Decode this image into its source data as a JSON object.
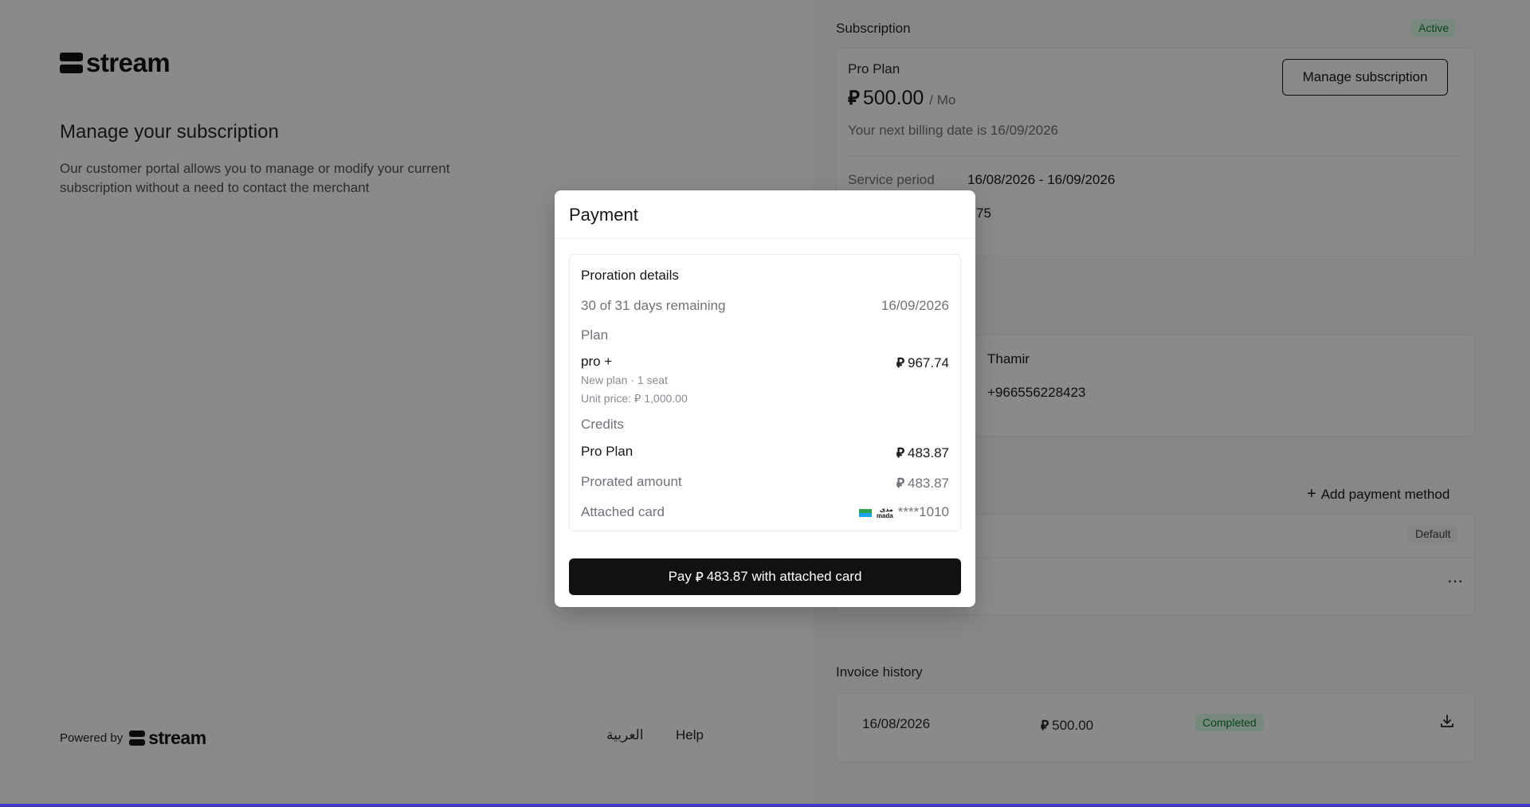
{
  "brand": {
    "wordmark": "stream"
  },
  "left": {
    "heading": "Manage your subscription",
    "description": "Our customer portal allows you to manage or modify your current subscription without a need to contact the merchant",
    "footer": {
      "powered_by": "Powered by",
      "arabic_link": "العربية",
      "help_link": "Help"
    }
  },
  "subscription": {
    "title": "Subscription",
    "status": "Active",
    "plan_name": "Pro Plan",
    "price": "500.00",
    "period": "/ Mo",
    "next_billing": "Your next billing date is 16/09/2026",
    "manage_button": "Manage subscription",
    "service_period_label": "Service period",
    "service_period_value": "16/08/2026 - 16/09/2026",
    "partial_value": "75"
  },
  "customer": {
    "name_partial": "Thamir",
    "phone_partial": "+966556228423"
  },
  "payment_methods": {
    "add_button": "Add payment method",
    "default_badge": "Default",
    "more_icon": "more-horizontal-icon"
  },
  "invoices": {
    "title": "Invoice history",
    "rows": [
      {
        "date": "16/08/2026",
        "amount": "500.00",
        "status": "Completed"
      }
    ]
  },
  "currency_symbol": "⃁",
  "modal": {
    "title": "Payment",
    "section_title": "Proration details",
    "days_remaining": "30 of 31 days remaining",
    "end_date": "16/09/2026",
    "plan_label": "Plan",
    "new_plan_name": "pro +",
    "new_plan_amount": "967.74",
    "new_plan_meta": "New plan · 1 seat",
    "unit_price_label": "Unit price:",
    "unit_price": "1,000.00",
    "credits_label": "Credits",
    "credit_plan": "Pro Plan",
    "credit_amount": "483.87",
    "prorated_label": "Prorated amount",
    "prorated_amount": "483.87",
    "attached_card_label": "Attached card",
    "card_brand_ar": "مدى",
    "card_brand": "mada",
    "card_masked": "****1010",
    "pay_prefix": "Pay",
    "pay_amount": "483.87",
    "pay_suffix": "with attached card"
  },
  "colors": {
    "accent_dark": "#111111",
    "active_green": "#15803d",
    "bottom_bar": "#4338ca"
  }
}
